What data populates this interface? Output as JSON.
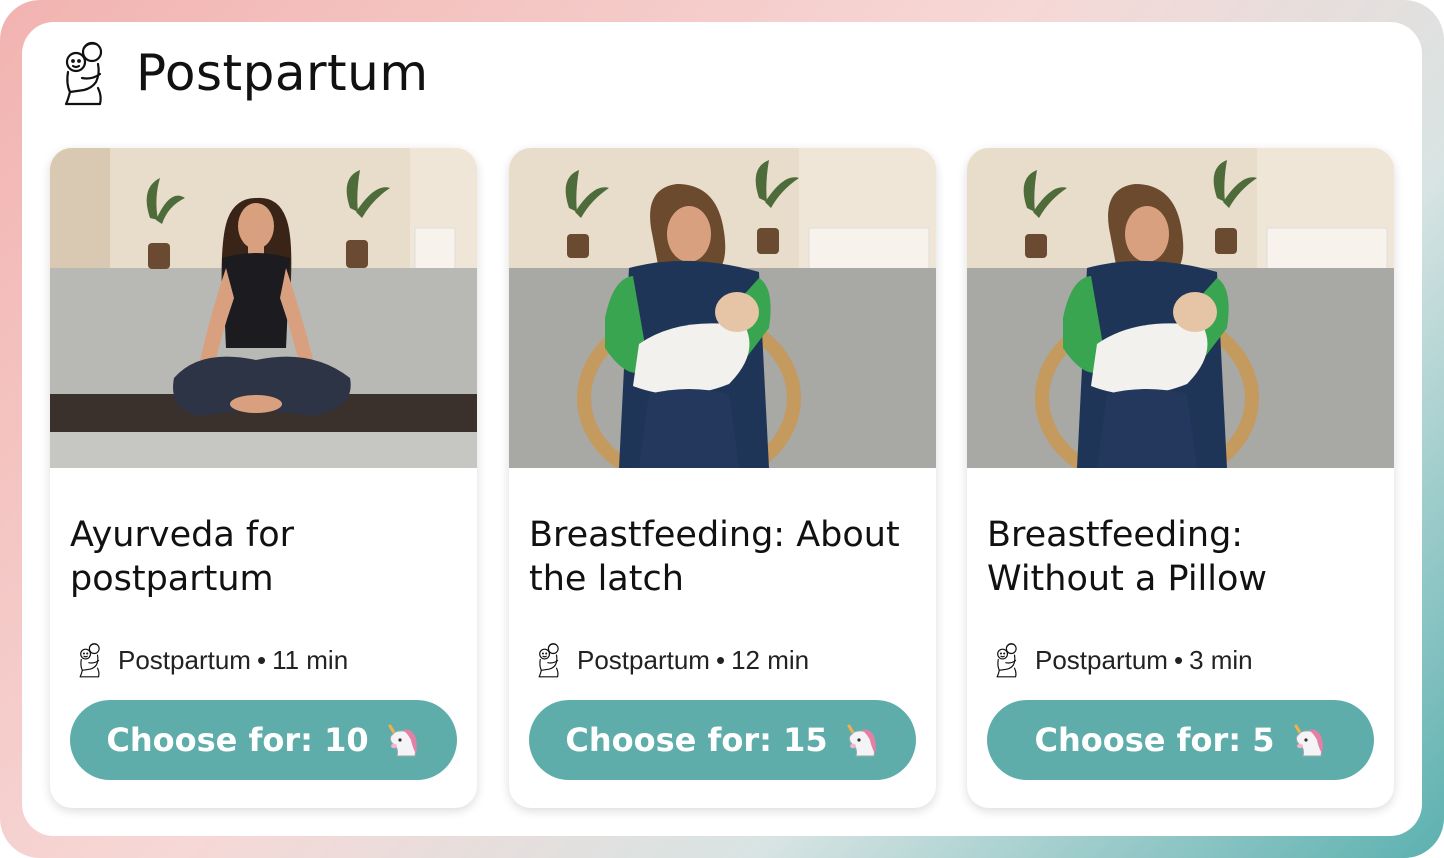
{
  "section": {
    "title": "Postpartum",
    "icon": "mother-baby-icon"
  },
  "cards": [
    {
      "title": "Ayurveda for postpartum",
      "category": "Postpartum",
      "separator": "•",
      "duration": "11 min",
      "button_label": "Choose for: 10",
      "button_icon": "unicorn-icon",
      "image": "woman-meditating-on-mat"
    },
    {
      "title": "Breastfeeding: About the latch",
      "category": "Postpartum",
      "separator": "•",
      "duration": "12 min",
      "button_label": "Choose for: 15",
      "button_icon": "unicorn-icon",
      "image": "woman-breastfeeding-in-chair"
    },
    {
      "title": "Breastfeeding: Without a Pillow",
      "category": "Postpartum",
      "separator": "•",
      "duration": "3 min",
      "button_label": "Choose for: 5",
      "button_icon": "unicorn-icon",
      "image": "woman-breastfeeding-in-chair"
    }
  ],
  "colors": {
    "accent": "#5fadab",
    "frame_start": "#f2b3b0",
    "frame_end": "#5bb1b0"
  }
}
